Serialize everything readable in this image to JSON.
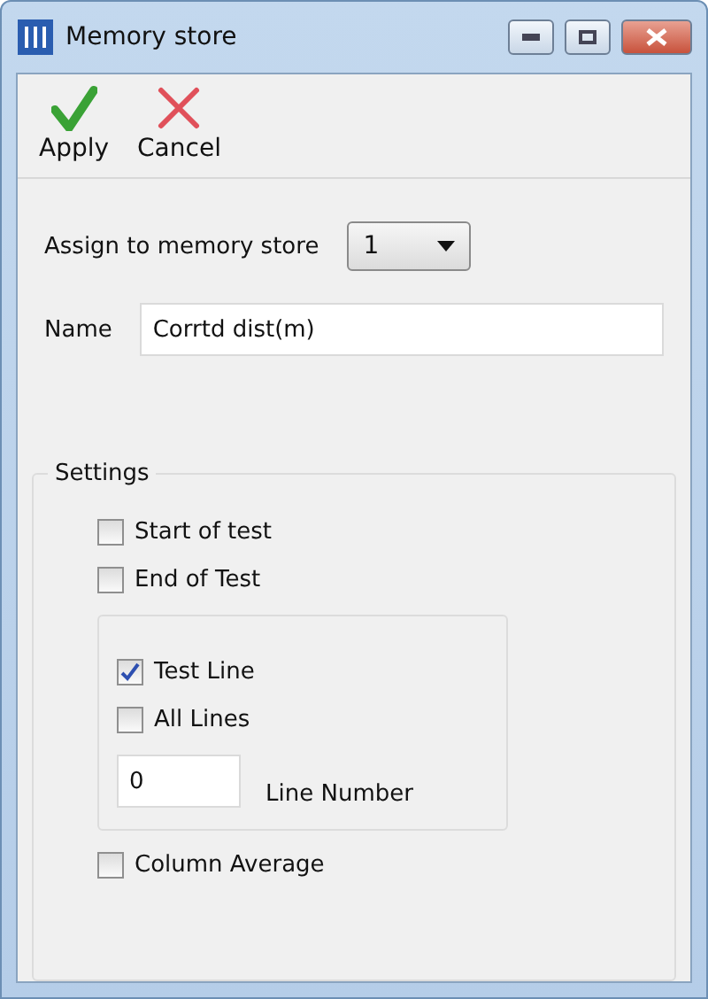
{
  "window": {
    "title": "Memory store"
  },
  "toolbar": [
    {
      "kind": "apply",
      "label": "Apply"
    },
    {
      "kind": "cancel",
      "label": "Cancel"
    }
  ],
  "assign": {
    "label": "Assign to memory store",
    "value": "1"
  },
  "name": {
    "label": "Name",
    "value": "Corrtd dist(m)"
  },
  "settings": {
    "title": "Settings",
    "top_options": [
      {
        "label": "Start of test",
        "checked": false
      },
      {
        "label": "End of Test",
        "checked": false
      }
    ],
    "line_options": [
      {
        "label": "Test Line",
        "checked": true
      },
      {
        "label": "All Lines",
        "checked": false
      }
    ],
    "line_number": {
      "value": "0",
      "label": "Line Number"
    },
    "bottom_options": [
      {
        "label": "Column Average",
        "checked": false
      }
    ]
  }
}
